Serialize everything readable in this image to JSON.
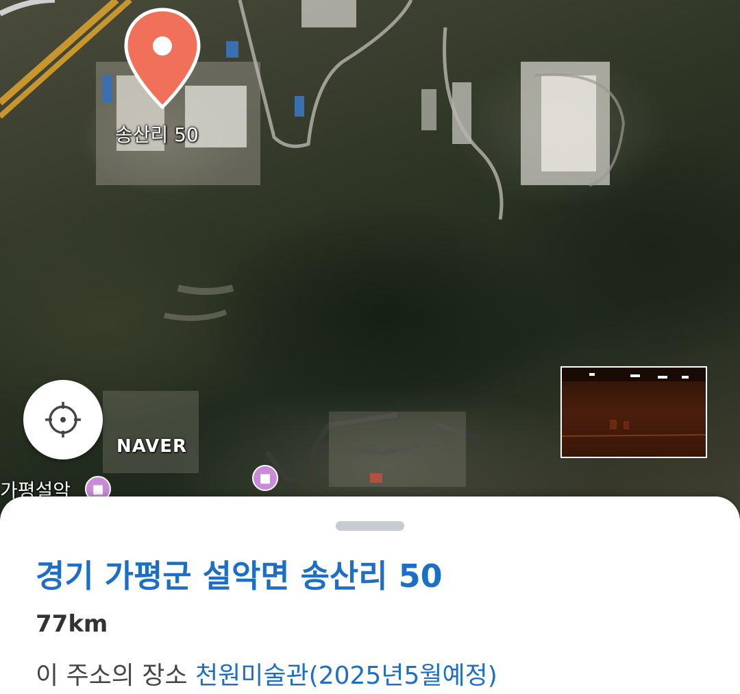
{
  "map": {
    "pin_label": "송산리 50",
    "provider_logo": "NAVER",
    "poi_label": "가평설악",
    "poi_icon": "hotel-icon",
    "locate_icon": "crosshair-icon",
    "accent_pin": "#f0705a"
  },
  "sheet": {
    "title": "경기 가평군 설악면 송산리 50",
    "distance": "77km",
    "place_prefix": "이 주소의 장소",
    "place_link": "천원미술관(2025년5월예정)",
    "accent_title": "#1c6fc4"
  }
}
